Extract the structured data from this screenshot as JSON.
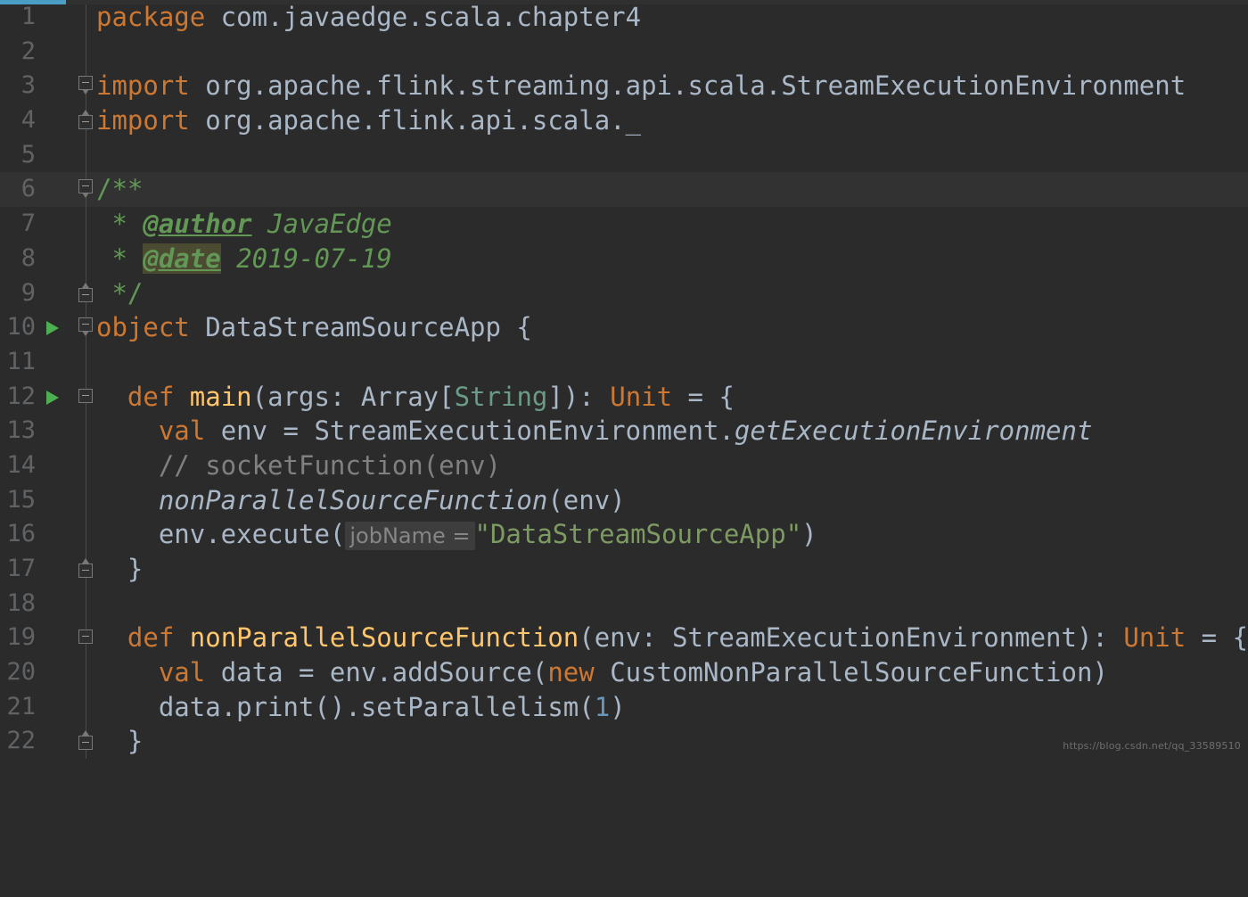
{
  "editor": {
    "theme": "Darcula",
    "language": "Scala",
    "colors": {
      "background": "#2b2b2b",
      "current_line_background": "#323232",
      "gutter_text": "#606366",
      "default_text": "#a9b7c6",
      "keyword": "#cc7832",
      "type": "#6a9b86",
      "number": "#6897bb",
      "string": "#7d9a62",
      "comment": "#808080",
      "doc_comment": "#629755",
      "method_declaration": "#ffc66d",
      "doc_tag_highlight": "#4b4b32",
      "run_marker": "#4caf50",
      "accent_bar": "#4a9ec4",
      "inlay_hint_background": "#3d3d3d",
      "inlay_hint_text": "#868686"
    },
    "current_line": 6,
    "run_marker_lines": [
      10,
      12
    ]
  },
  "watermark": {
    "text": "https://blog.csdn.net/qq_33589510"
  },
  "lines": [
    {
      "n": "1",
      "fold": "none"
    },
    {
      "n": "2",
      "fold": "none"
    },
    {
      "n": "3",
      "fold": "down"
    },
    {
      "n": "4",
      "fold": "up"
    },
    {
      "n": "5",
      "fold": "none"
    },
    {
      "n": "6",
      "fold": "down"
    },
    {
      "n": "7",
      "fold": "none"
    },
    {
      "n": "8",
      "fold": "none"
    },
    {
      "n": "9",
      "fold": "up"
    },
    {
      "n": "10",
      "fold": "down"
    },
    {
      "n": "11",
      "fold": "none"
    },
    {
      "n": "12",
      "fold": "mid"
    },
    {
      "n": "13",
      "fold": "none"
    },
    {
      "n": "14",
      "fold": "none"
    },
    {
      "n": "15",
      "fold": "none"
    },
    {
      "n": "16",
      "fold": "none"
    },
    {
      "n": "17",
      "fold": "up"
    },
    {
      "n": "18",
      "fold": "none"
    },
    {
      "n": "19",
      "fold": "mid"
    },
    {
      "n": "20",
      "fold": "none"
    },
    {
      "n": "21",
      "fold": "none"
    },
    {
      "n": "22",
      "fold": "up"
    }
  ],
  "code": {
    "l1": {
      "kw": "package",
      "rest": " com.javaedge.scala.chapter4"
    },
    "l2": {
      "text": ""
    },
    "l3": {
      "kw": "import",
      "rest": " org.apache.flink.streaming.api.scala.StreamExecutionEnvironment"
    },
    "l4": {
      "kw": "import",
      "rest": " org.apache.flink.api.scala._"
    },
    "l5": {
      "text": ""
    },
    "l6": {
      "text": "/**"
    },
    "l7": {
      "star": " * ",
      "tag": "@author",
      "value": " JavaEdge"
    },
    "l8": {
      "star": " * ",
      "tag": "@date",
      "value": " 2019-07-19"
    },
    "l9": {
      "text": " */"
    },
    "l10": {
      "kw": "object",
      "name": " DataStreamSourceApp",
      "tail": " {"
    },
    "l11": {
      "text": ""
    },
    "l12": {
      "indent": "  ",
      "kw": "def",
      "name": " main",
      "p1": "(args: ",
      "type1": "Array",
      "p2": "[",
      "type2": "String",
      "p3": "]): ",
      "ret": "Unit",
      "tail": " = {"
    },
    "l13": {
      "indent": "    ",
      "kw": "val",
      "mid": " env = StreamExecutionEnvironment.",
      "method": "getExecutionEnvironment"
    },
    "l14": {
      "indent": "    ",
      "comment": "// socketFunction(env)"
    },
    "l15": {
      "indent": "    ",
      "call": "nonParallelSourceFunction",
      "tail": "(env)"
    },
    "l16": {
      "indent": "    ",
      "head": "env.execute(",
      "hint": "jobName =",
      "str": "\"DataStreamSourceApp\"",
      "tail": ")"
    },
    "l17": {
      "text": "  }"
    },
    "l18": {
      "text": ""
    },
    "l19": {
      "indent": "  ",
      "kw": "def",
      "name": " nonParallelSourceFunction",
      "p1": "(env: StreamExecutionEnvironment): ",
      "ret": "Unit",
      "tail": " = {"
    },
    "l20": {
      "indent": "    ",
      "kw": "val",
      "mid": " data = env.addSource(",
      "kw2": "new",
      "tail": " CustomNonParallelSourceFunction)"
    },
    "l21": {
      "indent": "    ",
      "head": "data.print().setParallelism(",
      "num": "1",
      "tail": ")"
    },
    "l22": {
      "text": "  }"
    }
  }
}
